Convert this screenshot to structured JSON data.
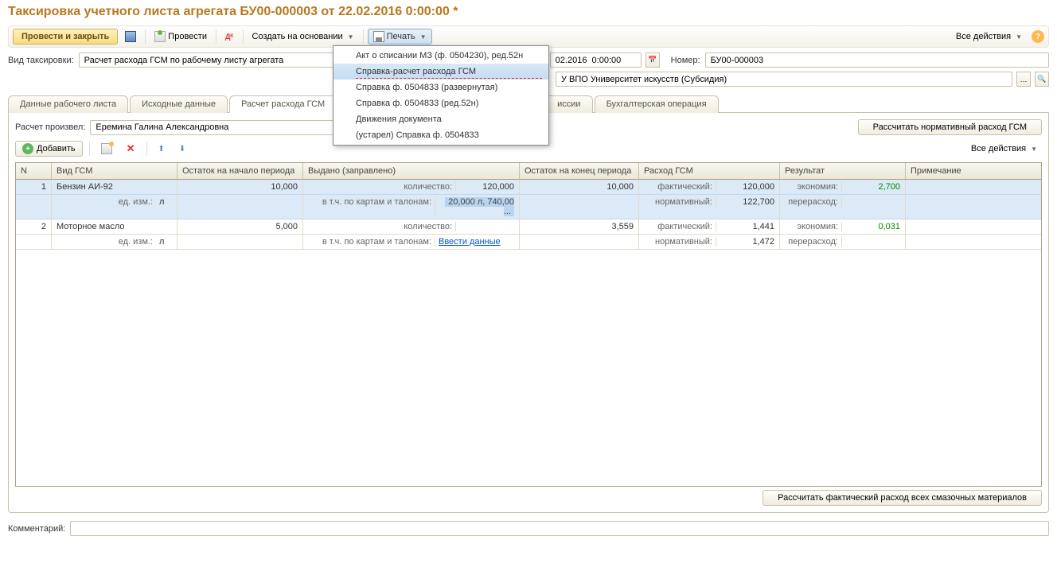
{
  "title": "Таксировка учетного листа агрегата БУ00-000003 от 22.02.2016 0:00:00 *",
  "toolbar": {
    "post_close": "Провести и закрыть",
    "post": "Провести",
    "create_based": "Создать на основании",
    "print": "Печать",
    "all_actions": "Все действия"
  },
  "fields": {
    "tax_type_label": "Вид таксировки:",
    "tax_type_value": "Расчет расхода ГСМ по рабочему листу агрегата",
    "date_partial": "02.2016  0:00:00",
    "number_label": "Номер:",
    "number_value": "БУ00-000003",
    "org_partial": "У ВПО Университет искусств (Субсидия)"
  },
  "tabs": {
    "t1": "Данные рабочего листа",
    "t2": "Исходные данные",
    "t3": "Расчет расхода ГСМ",
    "t4": "иссии",
    "t5": "Бухгалтерская операция"
  },
  "calc_row": {
    "label": "Расчет произвел:",
    "value": "Еремина Галина Александровна",
    "btn": "Рассчитать нормативный расход ГСМ"
  },
  "sub_toolbar": {
    "add": "Добавить",
    "all_actions": "Все действия"
  },
  "grid": {
    "headers": {
      "n": "N",
      "type": "Вид ГСМ",
      "start": "Остаток на начало периода",
      "issued": "Выдано (заправлено)",
      "end": "Остаток на конец периода",
      "consume": "Расход ГСМ",
      "result": "Результат",
      "note": "Примечание"
    },
    "labels": {
      "unit": "ед. изм.:",
      "unit_val": "л",
      "qty": "количество:",
      "cards": "в т.ч. по картам и талонам:",
      "actual": "фактический:",
      "norm": "нормативный:",
      "economy": "экономия:",
      "overrun": "перерасход:"
    },
    "rows": [
      {
        "n": "1",
        "type": "Бензин АИ-92",
        "start": "10,000",
        "qty": "120,000",
        "cards_val": "20,000 л, 740,00 ...",
        "end": "10,000",
        "actual": "120,000",
        "norm": "122,700",
        "economy": "2,700",
        "overrun": ""
      },
      {
        "n": "2",
        "type": "Моторное масло",
        "start": "5,000",
        "qty": "",
        "cards_link": "Ввести данные",
        "end": "3,559",
        "actual": "1,441",
        "norm": "1,472",
        "economy": "0,031",
        "overrun": ""
      }
    ]
  },
  "print_menu": {
    "m1": "Акт о списании МЗ (ф. 0504230), ред.52н",
    "m2": "Справка-расчет расхода ГСМ",
    "m3": "Справка ф. 0504833 (развернутая)",
    "m4": "Справка ф. 0504833 (ред.52н)",
    "m5": "Движения документа",
    "m6": "(устарел) Справка ф. 0504833"
  },
  "bottom": {
    "calc_all": "Рассчитать фактический расход всех смазочных материалов",
    "comment_label": "Комментарий:"
  }
}
